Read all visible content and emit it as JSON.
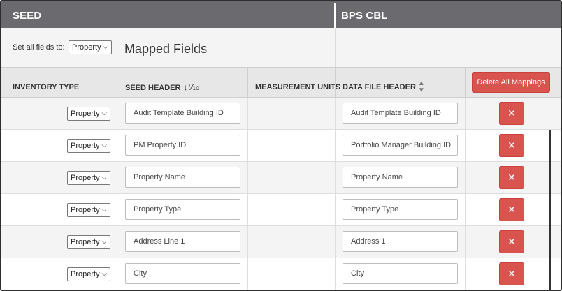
{
  "header": {
    "seed_label": "SEED",
    "bps_label": "BPS CBL"
  },
  "toolbar": {
    "set_all_label": "Set all fields to:",
    "set_all_value": "Property",
    "mapped_fields_title": "Mapped Fields"
  },
  "columns": {
    "inventory_type": "INVENTORY TYPE",
    "seed_header": "SEED HEADER",
    "measurement_units": "MEASUREMENT UNITS",
    "data_file_header": "DATA FILE HEADER",
    "delete_all": "Delete All Mappings"
  },
  "icons": {
    "sort_seed": "sort-alpha-down-icon",
    "sort_file": "sort-both-icon",
    "remove": "close-icon",
    "dropdown": "chevron-down-icon"
  },
  "colors": {
    "header_bg": "#6b6a6e",
    "danger": "#d9534f"
  },
  "rows": [
    {
      "inventory_type": "Property",
      "seed_header": "Audit Template Building ID",
      "file_header": "Audit Template Building ID"
    },
    {
      "inventory_type": "Property",
      "seed_header": "PM Property ID",
      "file_header": "Portfolio Manager Building ID"
    },
    {
      "inventory_type": "Property",
      "seed_header": "Property Name",
      "file_header": "Property Name"
    },
    {
      "inventory_type": "Property",
      "seed_header": "Property Type",
      "file_header": "Property Type"
    },
    {
      "inventory_type": "Property",
      "seed_header": "Address Line 1",
      "file_header": "Address 1"
    },
    {
      "inventory_type": "Property",
      "seed_header": "City",
      "file_header": "City"
    }
  ]
}
